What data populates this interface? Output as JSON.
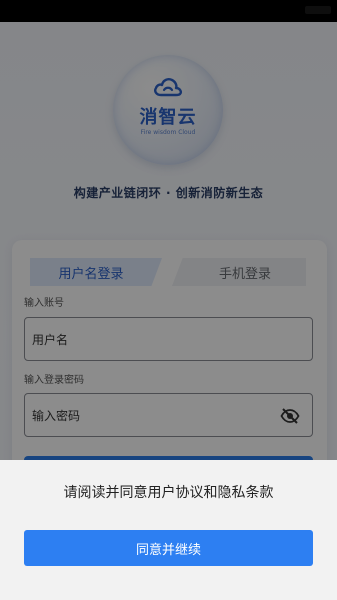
{
  "logo": {
    "name": "消智云",
    "tagline": "Fire wisdom Cloud",
    "icon": "cloud-icon"
  },
  "slogan": "构建产业链闭环 · 创新消防新生态",
  "tabs": [
    {
      "label": "用户名登录",
      "active": true
    },
    {
      "label": "手机登录",
      "active": false
    }
  ],
  "form": {
    "account_label": "输入账号",
    "account_placeholder": "用户名",
    "password_label": "输入登录密码",
    "password_placeholder": "输入密码",
    "password_toggle_icon": "eye-off-icon"
  },
  "consent_sheet": {
    "message": "请阅读并同意用户协议和隐私条款",
    "agree_label": "同意并继续"
  },
  "colors": {
    "accent": "#2d7ff2",
    "brand_text": "#2d62c9"
  }
}
